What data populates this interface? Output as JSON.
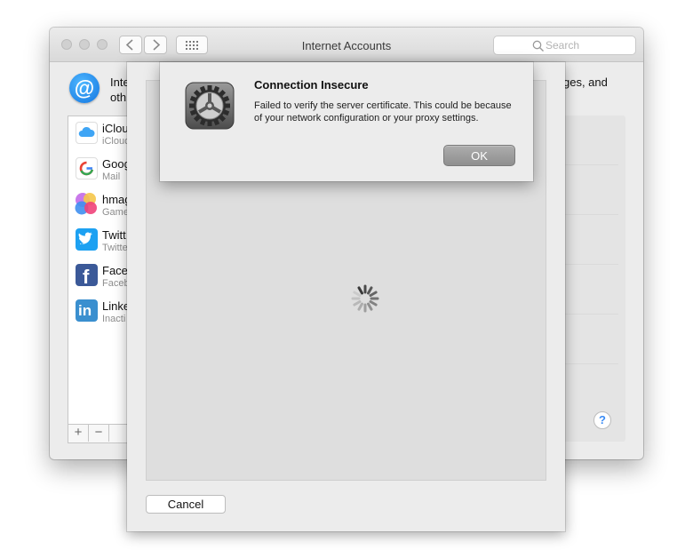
{
  "window": {
    "title": "Internet Accounts",
    "search_placeholder": "Search",
    "desc_line1_start": "Inter",
    "desc_line1_end": "ges, and",
    "desc_line2_start": "oth"
  },
  "accounts": [
    {
      "name": "iClou",
      "sub": "iCloud",
      "icon": "icloud-icon"
    },
    {
      "name": "Goog",
      "sub": "Mail",
      "icon": "google-icon"
    },
    {
      "name": "hmag",
      "sub": "Game",
      "icon": "game-center-icon"
    },
    {
      "name": "Twitt",
      "sub": "Twitte",
      "icon": "twitter-icon"
    },
    {
      "name": "Face",
      "sub": "Faceb",
      "icon": "facebook-icon"
    },
    {
      "name": "Linke",
      "sub": "Inacti",
      "icon": "linkedin-icon"
    }
  ],
  "toolbar": {
    "add": "+",
    "remove": "−"
  },
  "help": "?",
  "sheet": {
    "cancel_label": "Cancel"
  },
  "alert": {
    "title": "Connection Insecure",
    "message": "Failed to verify the server certificate. This could be because of your network configuration or your proxy settings.",
    "ok_label": "OK"
  },
  "colors": {
    "accent": "#1e8cf0",
    "twitter": "#1da1f2",
    "facebook": "#3b5998",
    "linkedin": "#3a8fcf"
  }
}
